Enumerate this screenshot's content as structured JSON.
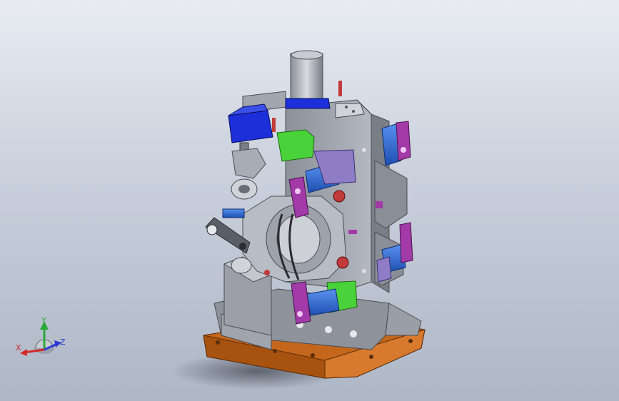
{
  "viewport": {
    "background_top": "#e8ecf2",
    "background_bottom": "#aeb7c6"
  },
  "model": {
    "description_icon": "fixture-assembly-3d-model",
    "part_colors": {
      "base_plate": "#c4661c",
      "frame": "#9a9ea6",
      "cylinder": "#2f6fd8",
      "clamp_arm": "#a23aa8",
      "valve_block": "#4ad23a",
      "motor": "#1c2fd8",
      "stop": "#c23a3a"
    }
  },
  "triad": {
    "x_label": "X",
    "y_label": "Y",
    "z_label": "Z",
    "x_color": "#d22a2a",
    "y_color": "#2aa83a",
    "z_color": "#2a3ad2"
  }
}
